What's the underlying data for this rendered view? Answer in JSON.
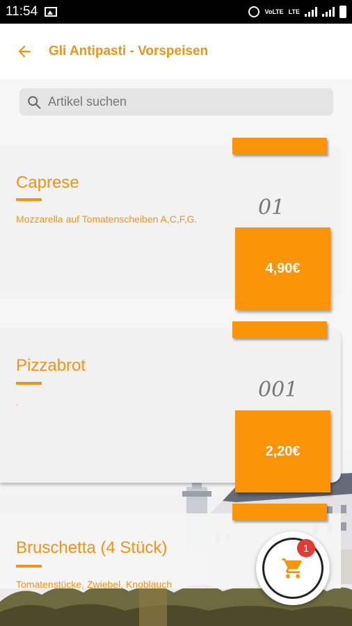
{
  "status_bar": {
    "time": "11:54",
    "network_1": "VoLTE",
    "network_2": "LTE"
  },
  "header": {
    "title": "Gli Antipasti - Vorspeisen",
    "back_icon": "arrow-left-icon"
  },
  "search": {
    "placeholder": "Artikel suchen",
    "icon": "search-icon"
  },
  "items": [
    {
      "name": "Caprese",
      "description": "Mozzarella auf Tomatenscheiben A,C,F,G.",
      "code": "01",
      "price": "4,90€"
    },
    {
      "name": "Pizzabrot",
      "description": ".",
      "code": "001",
      "price": "2,20€"
    },
    {
      "name": "Bruschetta (4 Stück)",
      "description": "Tomatenstücke, Zwiebel, Knoblauch",
      "code": "",
      "price": ""
    }
  ],
  "cart": {
    "count": "1",
    "icon": "cart-icon"
  },
  "colors": {
    "accent": "#f39313",
    "price_bg": "#fb9507",
    "badge": "#e53935"
  }
}
